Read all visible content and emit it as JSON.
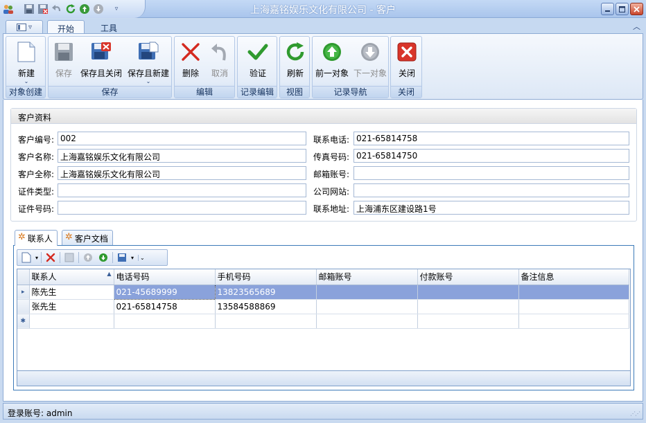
{
  "window": {
    "title": "上海嘉铭娱乐文化有限公司 - 客户"
  },
  "ribbon": {
    "tabs": [
      {
        "label": "开始"
      },
      {
        "label": "工具"
      }
    ],
    "groups": {
      "create": {
        "label": "对象创建",
        "new": "新建"
      },
      "save": {
        "label": "保存",
        "save": "保存",
        "save_close": "保存且关闭",
        "save_new": "保存且新建"
      },
      "edit": {
        "label": "编辑",
        "delete": "删除",
        "cancel": "取消"
      },
      "record_edit": {
        "label": "记录编辑",
        "validate": "验证"
      },
      "view": {
        "label": "视图",
        "refresh": "刷新"
      },
      "nav": {
        "label": "记录导航",
        "prev": "前一对象",
        "next": "下一对象"
      },
      "close": {
        "label": "关闭",
        "close": "关闭"
      }
    }
  },
  "customer": {
    "section_title": "客户资料",
    "fields": {
      "code": {
        "label": "客户编号:",
        "value": "002"
      },
      "name": {
        "label": "客户名称:",
        "value": "上海嘉铭娱乐文化有限公司"
      },
      "fullname": {
        "label": "客户全称:",
        "value": "上海嘉铭娱乐文化有限公司"
      },
      "id_type": {
        "label": "证件类型:",
        "value": ""
      },
      "id_no": {
        "label": "证件号码:",
        "value": ""
      },
      "phone": {
        "label": "联系电话:",
        "value": "021-65814758"
      },
      "fax": {
        "label": "传真号码:",
        "value": "021-65814750"
      },
      "email": {
        "label": "邮箱账号:",
        "value": ""
      },
      "website": {
        "label": "公司网站:",
        "value": ""
      },
      "address": {
        "label": "联系地址:",
        "value": "上海浦东区建设路1号"
      }
    }
  },
  "subtabs": [
    {
      "label": "联系人"
    },
    {
      "label": "客户文档"
    }
  ],
  "grid": {
    "columns": [
      "联系人",
      "电话号码",
      "手机号码",
      "邮箱账号",
      "付款账号",
      "备注信息"
    ],
    "rows": [
      [
        "陈先生",
        "021-45689999",
        "13823565689",
        "",
        "",
        ""
      ],
      [
        "张先生",
        "021-65814758",
        "13584588869",
        "",
        "",
        ""
      ]
    ]
  },
  "status": {
    "login": "登录账号: admin"
  }
}
